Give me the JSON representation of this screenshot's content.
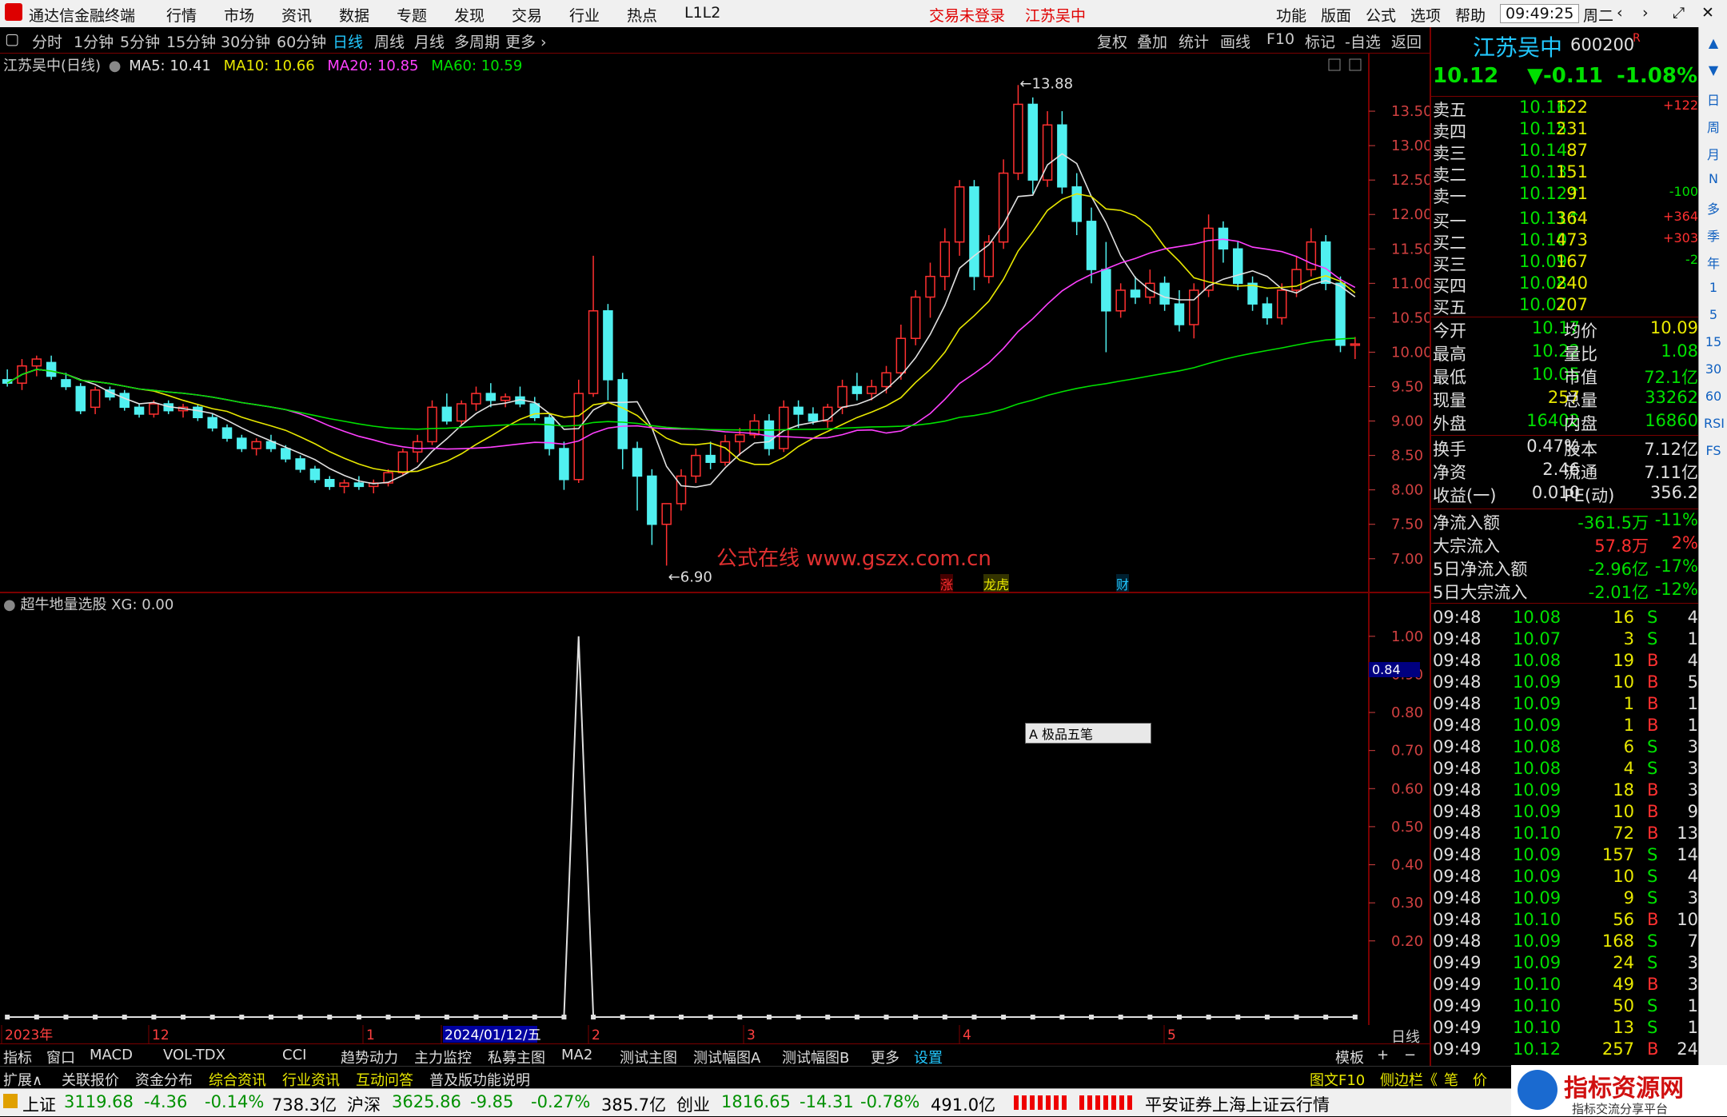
{
  "menubar": {
    "app_title": "通达信金融终端",
    "menus": [
      "行情",
      "市场",
      "资讯",
      "数据",
      "专题",
      "发现",
      "交易",
      "行业",
      "热点",
      "L1L2"
    ],
    "login_status": "交易未登录",
    "stock_title": "江苏吴中",
    "right_menus": [
      "功能",
      "版面",
      "公式",
      "选项",
      "帮助"
    ],
    "clock": "09:49:25",
    "weekday": "周二",
    "win_buttons": [
      "‹",
      "›",
      "⤢",
      "✕"
    ]
  },
  "period_bar": {
    "items": [
      "分时",
      "1分钟",
      "5分钟",
      "15分钟",
      "30分钟",
      "60分钟",
      "日线",
      "周线",
      "月线",
      "多周期",
      "更多 ›"
    ],
    "active": "日线",
    "right_items": [
      "复权",
      "叠加",
      "统计",
      "画线",
      "F10",
      "标记",
      "-自选",
      "返回"
    ]
  },
  "main_chart": {
    "header_name": "江苏吴中(日线)",
    "ma_labels": [
      {
        "text": "MA5: 10.41",
        "color": "#e0e0e0"
      },
      {
        "text": "MA10: 10.66",
        "color": "#e8e800"
      },
      {
        "text": "MA20: 10.85",
        "color": "#ff40ff"
      },
      {
        "text": "MA60: 10.59",
        "color": "#00e000"
      }
    ],
    "price_ticks": [
      "13.50",
      "13.00",
      "12.50",
      "12.00",
      "11.50",
      "11.00",
      "10.50",
      "10.00",
      "9.50",
      "9.00",
      "8.50",
      "8.00",
      "7.50",
      "7.00"
    ],
    "high_marker": "13.88",
    "low_marker": "6.90",
    "watermark": "公式在线 www.gszx.com.cn",
    "tags": [
      {
        "text": "涨",
        "color": "#ff3030"
      },
      {
        "text": "龙虎",
        "color": "#e8e800"
      },
      {
        "text": "财",
        "color": "#22c8ff"
      }
    ]
  },
  "chart_data": [
    {
      "type": "candlestick",
      "title": "江苏吴中(日线)",
      "ylim": [
        6.8,
        14.0
      ],
      "ohlc": [
        [
          9.6,
          9.75,
          9.5,
          9.55
        ],
        [
          9.55,
          9.9,
          9.45,
          9.8
        ],
        [
          9.8,
          9.95,
          9.65,
          9.9
        ],
        [
          9.85,
          9.95,
          9.6,
          9.65
        ],
        [
          9.6,
          9.7,
          9.45,
          9.5
        ],
        [
          9.5,
          9.55,
          9.1,
          9.15
        ],
        [
          9.2,
          9.5,
          9.1,
          9.45
        ],
        [
          9.45,
          9.5,
          9.3,
          9.35
        ],
        [
          9.4,
          9.45,
          9.15,
          9.2
        ],
        [
          9.2,
          9.25,
          9.05,
          9.1
        ],
        [
          9.1,
          9.3,
          9.05,
          9.25
        ],
        [
          9.25,
          9.3,
          9.1,
          9.15
        ],
        [
          9.15,
          9.25,
          9.05,
          9.2
        ],
        [
          9.2,
          9.25,
          9.0,
          9.05
        ],
        [
          9.05,
          9.1,
          8.85,
          8.9
        ],
        [
          8.9,
          8.95,
          8.7,
          8.75
        ],
        [
          8.75,
          8.8,
          8.55,
          8.6
        ],
        [
          8.6,
          8.75,
          8.5,
          8.7
        ],
        [
          8.7,
          8.8,
          8.55,
          8.6
        ],
        [
          8.6,
          8.65,
          8.4,
          8.45
        ],
        [
          8.45,
          8.5,
          8.25,
          8.3
        ],
        [
          8.3,
          8.35,
          8.1,
          8.15
        ],
        [
          8.15,
          8.2,
          8.0,
          8.05
        ],
        [
          8.05,
          8.15,
          7.95,
          8.1
        ],
        [
          8.1,
          8.2,
          8.0,
          8.05
        ],
        [
          8.05,
          8.15,
          7.95,
          8.1
        ],
        [
          8.1,
          8.3,
          8.05,
          8.25
        ],
        [
          8.25,
          8.6,
          8.2,
          8.55
        ],
        [
          8.55,
          8.8,
          8.4,
          8.7
        ],
        [
          8.7,
          9.3,
          8.65,
          9.2
        ],
        [
          9.2,
          9.4,
          8.95,
          9.0
        ],
        [
          9.0,
          9.3,
          8.95,
          9.25
        ],
        [
          9.25,
          9.5,
          9.15,
          9.4
        ],
        [
          9.4,
          9.55,
          9.2,
          9.3
        ],
        [
          9.3,
          9.4,
          9.2,
          9.35
        ],
        [
          9.35,
          9.5,
          9.2,
          9.25
        ],
        [
          9.25,
          9.35,
          9.0,
          9.05
        ],
        [
          9.05,
          9.1,
          8.5,
          8.6
        ],
        [
          8.6,
          8.7,
          8.0,
          8.15
        ],
        [
          8.15,
          9.6,
          8.1,
          9.4
        ],
        [
          9.4,
          11.4,
          9.35,
          10.6
        ],
        [
          10.6,
          10.7,
          9.3,
          9.6
        ],
        [
          9.6,
          9.7,
          8.3,
          8.6
        ],
        [
          8.6,
          8.7,
          7.7,
          8.2
        ],
        [
          8.2,
          8.3,
          7.2,
          7.5
        ],
        [
          7.5,
          7.7,
          6.9,
          7.8
        ],
        [
          7.8,
          8.3,
          7.7,
          8.2
        ],
        [
          8.2,
          8.6,
          8.1,
          8.5
        ],
        [
          8.5,
          8.7,
          8.3,
          8.4
        ],
        [
          8.4,
          8.8,
          8.35,
          8.7
        ],
        [
          8.7,
          8.9,
          8.5,
          8.8
        ],
        [
          8.8,
          9.1,
          8.75,
          9.0
        ],
        [
          9.0,
          9.1,
          8.5,
          8.6
        ],
        [
          8.6,
          9.3,
          8.55,
          9.2
        ],
        [
          9.2,
          9.3,
          8.9,
          9.1
        ],
        [
          9.1,
          9.2,
          8.95,
          9.0
        ],
        [
          9.0,
          9.25,
          8.9,
          9.2
        ],
        [
          9.2,
          9.6,
          9.1,
          9.5
        ],
        [
          9.5,
          9.7,
          9.3,
          9.4
        ],
        [
          9.4,
          9.6,
          9.3,
          9.5
        ],
        [
          9.5,
          9.8,
          9.4,
          9.7
        ],
        [
          9.7,
          10.4,
          9.6,
          10.2
        ],
        [
          10.2,
          10.9,
          10.1,
          10.8
        ],
        [
          10.8,
          11.3,
          10.5,
          11.1
        ],
        [
          11.1,
          11.8,
          10.9,
          11.6
        ],
        [
          11.6,
          12.5,
          11.4,
          12.4
        ],
        [
          12.4,
          12.5,
          10.9,
          11.1
        ],
        [
          11.1,
          11.7,
          11.0,
          11.6
        ],
        [
          11.6,
          12.8,
          11.5,
          12.6
        ],
        [
          12.6,
          13.88,
          12.5,
          13.6
        ],
        [
          13.6,
          13.7,
          12.3,
          12.5
        ],
        [
          12.5,
          13.5,
          12.4,
          13.3
        ],
        [
          13.3,
          13.5,
          12.3,
          12.4
        ],
        [
          12.4,
          12.6,
          11.7,
          11.9
        ],
        [
          11.9,
          12.1,
          11.0,
          11.2
        ],
        [
          11.2,
          11.6,
          10.0,
          10.6
        ],
        [
          10.6,
          11.0,
          10.5,
          10.9
        ],
        [
          10.9,
          11.1,
          10.7,
          10.8
        ],
        [
          10.8,
          11.2,
          10.7,
          11.0
        ],
        [
          11.0,
          11.1,
          10.6,
          10.7
        ],
        [
          10.7,
          10.9,
          10.3,
          10.4
        ],
        [
          10.4,
          11.0,
          10.2,
          10.9
        ],
        [
          10.9,
          12.0,
          10.8,
          11.8
        ],
        [
          11.8,
          11.9,
          11.3,
          11.5
        ],
        [
          11.5,
          11.6,
          10.9,
          11.0
        ],
        [
          11.0,
          11.1,
          10.6,
          10.7
        ],
        [
          10.7,
          10.8,
          10.4,
          10.5
        ],
        [
          10.5,
          11.0,
          10.4,
          10.9
        ],
        [
          10.9,
          11.4,
          10.8,
          11.2
        ],
        [
          11.2,
          11.8,
          11.1,
          11.6
        ],
        [
          11.6,
          11.7,
          10.9,
          11.0
        ],
        [
          11.0,
          11.1,
          10.0,
          10.1
        ],
        [
          10.1,
          10.22,
          9.9,
          10.12
        ]
      ]
    },
    {
      "type": "line",
      "title": "超牛地量选股",
      "series": [
        {
          "name": "XG",
          "values": [
            0,
            0,
            0,
            0,
            0,
            0,
            0,
            0,
            0,
            0,
            0,
            0,
            0,
            0,
            0,
            0,
            0,
            0,
            0,
            0,
            0,
            0,
            0,
            0,
            0,
            0,
            0,
            0,
            0,
            0,
            0,
            0,
            0,
            0,
            0,
            0,
            0,
            0,
            0,
            0,
            0,
            0,
            0,
            0,
            0,
            0,
            0,
            0,
            0,
            0,
            0,
            0,
            0,
            0,
            0,
            0,
            0,
            0,
            0,
            0,
            0,
            0,
            0,
            0,
            0,
            0,
            0,
            0,
            0,
            0,
            0,
            0,
            0,
            0,
            0,
            0,
            0,
            0,
            0,
            0,
            0,
            0,
            0,
            0,
            0,
            0,
            0,
            0,
            0,
            0,
            0,
            0,
            0
          ]
        }
      ],
      "spike_index": 39,
      "spike_value": 1.0,
      "ylim": [
        0,
        1.05
      ],
      "y_ticks": [
        "1.00",
        "0.90",
        "0.80",
        "0.70",
        "0.60",
        "0.50",
        "0.40",
        "0.30",
        "0.20"
      ],
      "x_labels": [
        "2023年",
        "12",
        "1",
        "2024/01/12/五",
        "2",
        "3",
        "4",
        "5"
      ]
    }
  ],
  "indicator": {
    "header": "超牛地量选股  XG: 0.00",
    "cursor_value": "0.84",
    "ime_popup": "A 极品五笔"
  },
  "quote": {
    "name": "江苏吴中",
    "code": "600200",
    "price": "10.12",
    "change": "▼-0.11",
    "change_pct": "-1.08%",
    "asks": [
      {
        "label": "卖五",
        "price": "10.16",
        "vol": "122",
        "chg": "+122"
      },
      {
        "label": "卖四",
        "price": "10.15",
        "vol": "231",
        "chg": ""
      },
      {
        "label": "卖三",
        "price": "10.14",
        "vol": "87",
        "chg": ""
      },
      {
        "label": "卖二",
        "price": "10.13",
        "vol": "151",
        "chg": ""
      },
      {
        "label": "卖一",
        "price": "10.12↑",
        "vol": "91",
        "chg": "-100"
      }
    ],
    "bids": [
      {
        "label": "买一",
        "price": "10.11↑",
        "vol": "364",
        "chg": "+364"
      },
      {
        "label": "买二",
        "price": "10.10",
        "vol": "473",
        "chg": "+303"
      },
      {
        "label": "买三",
        "price": "10.09",
        "vol": "167",
        "chg": "-2"
      },
      {
        "label": "买四",
        "price": "10.08",
        "vol": "240",
        "chg": ""
      },
      {
        "label": "买五",
        "price": "10.07",
        "vol": "207",
        "chg": ""
      }
    ],
    "stats": [
      [
        "今开",
        "10.17",
        "均价",
        "10.09"
      ],
      [
        "最高",
        "10.22",
        "量比",
        "1.08"
      ],
      [
        "最低",
        "10.05",
        "市值",
        "72.1亿"
      ],
      [
        "现量",
        "257",
        "总量",
        "33262"
      ],
      [
        "外盘",
        "16402",
        "内盘",
        "16860"
      ]
    ],
    "stats2": [
      [
        "换手",
        "0.47%",
        "股本",
        "7.12亿"
      ],
      [
        "净资",
        "2.46",
        "流通",
        "7.11亿"
      ],
      [
        "收益(一)",
        "0.010",
        "PE(动)",
        "356.2"
      ]
    ],
    "flows": [
      [
        "净流入额",
        "-361.5万",
        "-11%"
      ],
      [
        "大宗流入",
        "57.8万",
        "2%"
      ],
      [
        "5日净流入额",
        "-2.96亿",
        "-17%"
      ],
      [
        "5日大宗流入",
        "-2.01亿",
        "-12%"
      ]
    ],
    "ticks": [
      [
        "09:48",
        "10.08",
        "16",
        "S",
        "4"
      ],
      [
        "09:48",
        "10.07",
        "3",
        "S",
        "1"
      ],
      [
        "09:48",
        "10.08",
        "19",
        "B",
        "4"
      ],
      [
        "09:48",
        "10.09",
        "10",
        "B",
        "5"
      ],
      [
        "09:48",
        "10.09",
        "1",
        "B",
        "1"
      ],
      [
        "09:48",
        "10.09",
        "1",
        "B",
        "1"
      ],
      [
        "09:48",
        "10.08",
        "6",
        "S",
        "3"
      ],
      [
        "09:48",
        "10.08",
        "4",
        "S",
        "3"
      ],
      [
        "09:48",
        "10.09",
        "18",
        "B",
        "3"
      ],
      [
        "09:48",
        "10.09",
        "10",
        "B",
        "9"
      ],
      [
        "09:48",
        "10.10",
        "72",
        "B",
        "13"
      ],
      [
        "09:48",
        "10.09",
        "157",
        "S",
        "14"
      ],
      [
        "09:48",
        "10.09",
        "10",
        "S",
        "4"
      ],
      [
        "09:48",
        "10.09",
        "9",
        "S",
        "3"
      ],
      [
        "09:48",
        "10.10",
        "56",
        "B",
        "10"
      ],
      [
        "09:48",
        "10.09",
        "168",
        "S",
        "7"
      ],
      [
        "09:49",
        "10.09",
        "24",
        "S",
        "3"
      ],
      [
        "09:49",
        "10.10",
        "49",
        "B",
        "3"
      ],
      [
        "09:49",
        "10.10",
        "50",
        "S",
        "1"
      ],
      [
        "09:49",
        "10.10",
        "13",
        "S",
        "1"
      ],
      [
        "09:49",
        "10.12",
        "257",
        "B",
        "24"
      ]
    ]
  },
  "side_strip": [
    "▲",
    "▼",
    "日",
    "周",
    "月",
    "N",
    "多",
    "季",
    "年",
    "1",
    "5",
    "15",
    "30",
    "60",
    "RSI",
    "FS"
  ],
  "tabs_row1": [
    "指标",
    "窗口",
    "MACD",
    "VOL-TDX",
    "CCI",
    "趋势动力",
    "主力监控",
    "私募主图",
    "MA2",
    "测试主图",
    "测试幅图A",
    "测试幅图B",
    "更多",
    "设置"
  ],
  "tabs_row1_right": [
    "模板",
    "+",
    "−"
  ],
  "tabs_row2": [
    "扩展∧",
    "关联报价",
    "资金分布",
    "综合资讯",
    "行业资讯",
    "互动问答",
    "普及版功能说明"
  ],
  "tabs_row2_right": [
    "图文F10",
    "侧边栏《",
    "笔",
    "价"
  ],
  "period_label": "日线",
  "statusbar": {
    "items": [
      {
        "name": "上证",
        "value": "3119.68",
        "chg": "-4.36",
        "pct": "-0.14%",
        "amt": "738.3亿"
      },
      {
        "name": "沪深",
        "value": "3625.86",
        "chg": "-9.85",
        "pct": "-0.27%",
        "amt": "385.7亿"
      },
      {
        "name": "创业",
        "value": "1816.65",
        "chg": "-14.31",
        "pct": "-0.78%",
        "amt": "491.0亿"
      }
    ],
    "broker": "平安证券上海上证云行情",
    "brand": "指标资源网",
    "brand_sub": "指标交流分享平台"
  }
}
